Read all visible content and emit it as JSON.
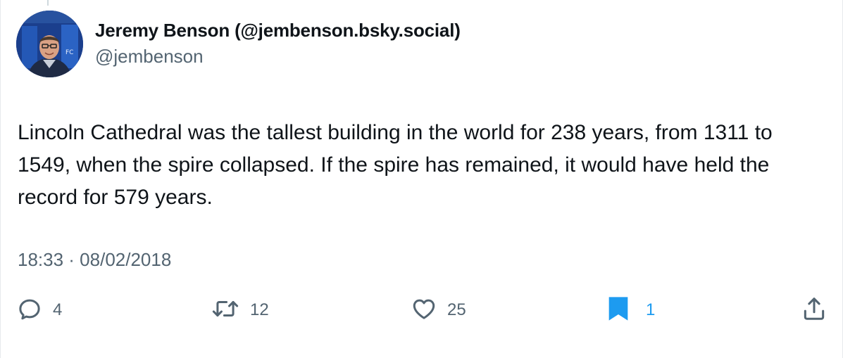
{
  "author": {
    "name": "Jeremy Benson (@jembenson.bsky.social)",
    "handle": "@jembenson"
  },
  "tweet": {
    "text": "Lincoln Cathedral was the tallest building in the world for 238 years, from 1311 to 1549, when the spire collapsed. If the spire has remained, it would have held the record for 579 years.",
    "timestamp": "18:33 · 08/02/2018"
  },
  "actions": {
    "reply": {
      "icon": "reply-icon",
      "count": "4"
    },
    "retweet": {
      "icon": "retweet-icon",
      "count": "12"
    },
    "like": {
      "icon": "heart-icon",
      "count": "25"
    },
    "bookmark": {
      "icon": "bookmark-icon",
      "count": "1",
      "active": true
    },
    "share": {
      "icon": "share-icon"
    }
  },
  "colors": {
    "text": "#0f1419",
    "secondary": "#536471",
    "accent": "#1d9bf0"
  }
}
